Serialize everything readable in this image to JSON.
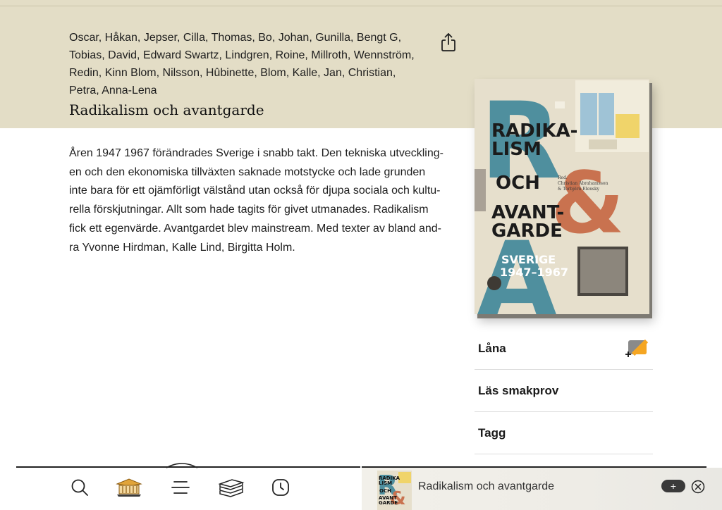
{
  "header": {
    "authors_lines": [
      "Oscar, Håkan, Jepser, Cilla, Thomas, Bo, Johan, Gunilla, Bengt G,",
      "Tobias, David, Edward Swartz, Lindgren, Roine, Millroth, Wennström,",
      "Redin, Kinn Blom, Nilsson, Hûbinette, Blom, Kalle, Jan, Christian,",
      "Petra, Anna-Lena"
    ],
    "title": "Radikalism och avantgarde",
    "share_icon": "share-icon"
  },
  "description": {
    "lines": [
      "Åren 1947 1967 förändrades Sverige i snabb takt. Den tekniska utveckling-",
      "en och den ekonomiska tillväxten saknade motstycke och lade grunden",
      "inte bara för ett ojämförligt välstånd utan också för djupa sociala och kultu-",
      "rella förskjutningar. Allt som hade tagits för givet utmanades. Radikalism",
      "fick ett egenvärde. Avantgardet blev mainstream. Med texter av bland and-",
      "ra Yvonne Hirdman, Kalle Lind, Birgitta Holm."
    ]
  },
  "cover": {
    "title_lines": [
      "RADIKA-",
      "LISM",
      "OCH",
      "AVANT-",
      "GARDE"
    ],
    "subtitle_lines": [
      "SVERIGE",
      "1947–1967"
    ],
    "editors_lines": [
      "Red.",
      "Christian Abrahamsson",
      "& Torbjörn Elensky"
    ],
    "letter_r": "R",
    "letter_amp": "&",
    "letter_a": "A"
  },
  "actions": [
    {
      "label": "Låna",
      "icon": "borrow-icon"
    },
    {
      "label": "Läs smakprov",
      "icon": null
    },
    {
      "label": "Tagg",
      "icon": null
    }
  ],
  "tabbar": {
    "tabs": [
      "search-icon",
      "library-icon",
      "menu-icon",
      "books-icon",
      "history-icon"
    ]
  },
  "mini_player": {
    "title": "Radikalism och avantgarde",
    "cover_lines": [
      "RADIKA",
      "LISM",
      "OCH",
      "AVANT",
      "GARDE"
    ],
    "add_label": "+"
  },
  "colors": {
    "header_bg": "#e3ddc6",
    "cover_teal": "#4f8f9e",
    "cover_orange": "#c9724f",
    "cover_bg": "#e6dfcc",
    "accent_orange": "#f5a623"
  }
}
